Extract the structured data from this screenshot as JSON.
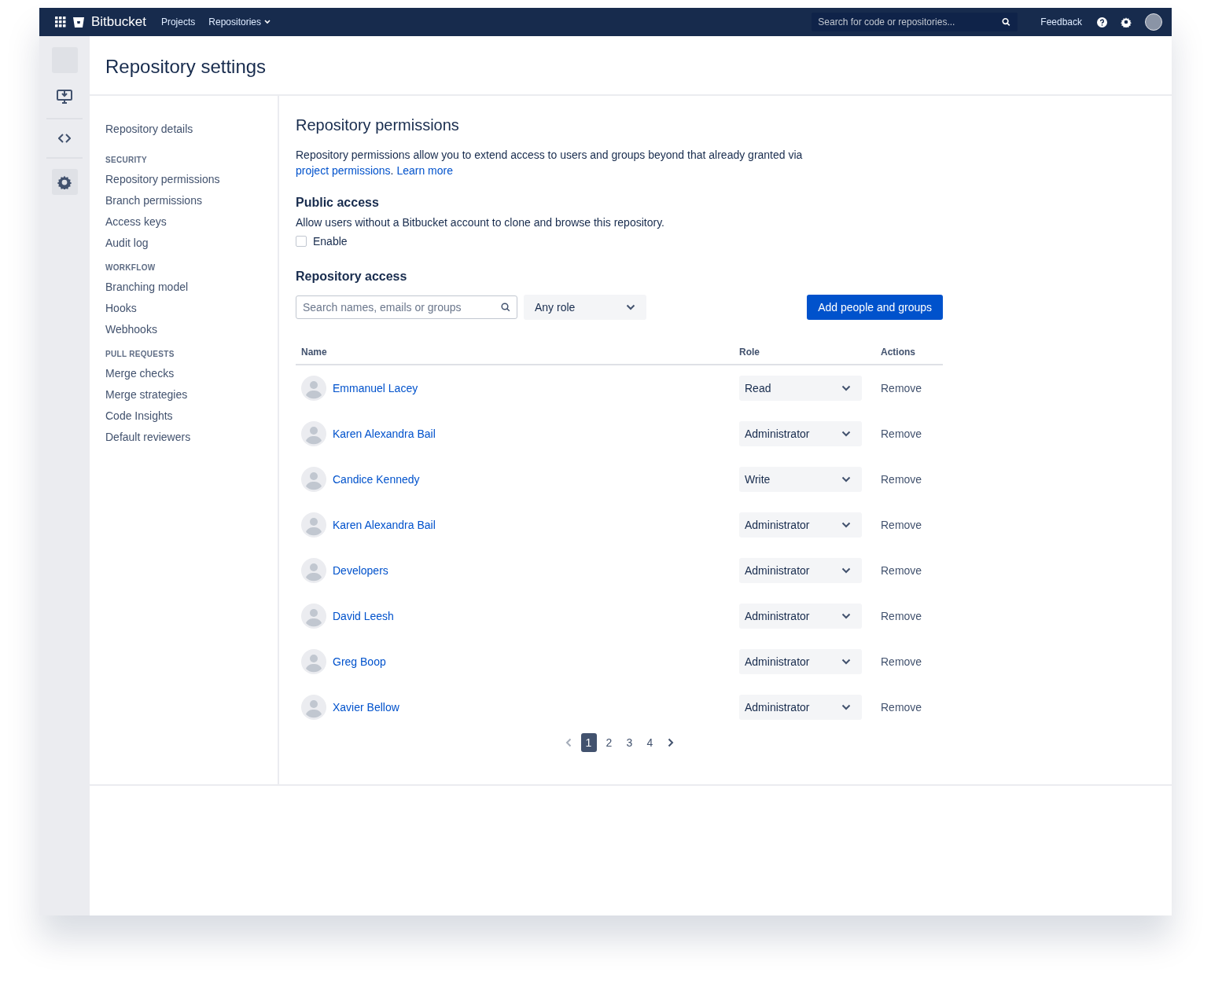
{
  "topbar": {
    "product": "Bitbucket",
    "nav": [
      {
        "label": "Projects",
        "dropdown": false
      },
      {
        "label": "Repositories",
        "dropdown": true
      }
    ],
    "search": {
      "placeholder": "Search for code or repositories..."
    },
    "feedback": "Feedback"
  },
  "page_title": "Repository settings",
  "sidebar": {
    "top_item": "Repository details",
    "sections": [
      {
        "heading": "SECURITY",
        "items": [
          "Repository permissions",
          "Branch permissions",
          "Access keys",
          "Audit log"
        ]
      },
      {
        "heading": "WORKFLOW",
        "items": [
          "Branching model",
          "Hooks",
          "Webhooks"
        ]
      },
      {
        "heading": "PULL REQUESTS",
        "items": [
          "Merge checks",
          "Merge strategies",
          "Code Insights",
          "Default reviewers"
        ]
      }
    ]
  },
  "permissions": {
    "title": "Repository permissions",
    "intro": "Repository permissions allow you to extend access to users and groups beyond that already granted via",
    "intro_link": "project permissions",
    "intro_end": ".",
    "learn_more": "Learn more"
  },
  "public_access": {
    "title": "Public access",
    "description": "Allow users without a Bitbucket account to clone and browse this repository.",
    "checkbox": {
      "label": "Enable",
      "checked": false
    }
  },
  "repository_access": {
    "title": "Repository access",
    "search": {
      "placeholder": "Search names, emails or groups"
    },
    "role_filter": "Any role",
    "add_button": "Add people and groups",
    "table": {
      "columns": [
        "Name",
        "Role",
        "Actions"
      ],
      "rows": [
        {
          "name": "Emmanuel Lacey",
          "role": "Read",
          "action": "Remove"
        },
        {
          "name": "Karen Alexandra Bail",
          "role": "Administrator",
          "action": "Remove"
        },
        {
          "name": "Candice Kennedy",
          "role": "Write",
          "action": "Remove"
        },
        {
          "name": "Karen Alexandra Bail",
          "role": "Administrator",
          "action": "Remove"
        },
        {
          "name": "Developers",
          "role": "Administrator",
          "action": "Remove"
        },
        {
          "name": "David Leesh",
          "role": "Administrator",
          "action": "Remove"
        },
        {
          "name": "Greg Boop",
          "role": "Administrator",
          "action": "Remove"
        },
        {
          "name": "Xavier Bellow",
          "role": "Administrator",
          "action": "Remove"
        }
      ]
    },
    "pagination": {
      "prev_disabled": true,
      "next_disabled": false,
      "pages": [
        {
          "label": "1",
          "selected": true
        },
        {
          "label": "2",
          "selected": false
        },
        {
          "label": "3",
          "selected": false
        },
        {
          "label": "4",
          "selected": false
        }
      ]
    }
  }
}
